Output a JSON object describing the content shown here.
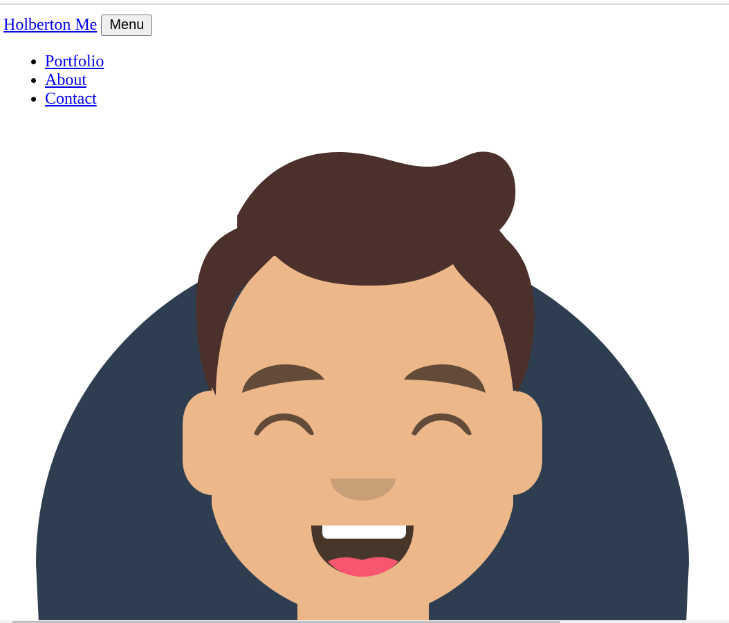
{
  "header": {
    "brand": "Holberton Me",
    "menu_button": "Menu"
  },
  "nav": {
    "items": [
      {
        "label": "Portfolio"
      },
      {
        "label": "About"
      },
      {
        "label": "Contact"
      }
    ]
  },
  "avatar": {
    "icon": "smiling-person-avatar",
    "colors": {
      "background_circle": "#2e3e50",
      "skin": "#ecb789",
      "hair": "#4b302c",
      "eyebrows": "#624b39",
      "nose": "#c99f77",
      "mouth": "#47372a",
      "teeth": "#ffffff",
      "tongue": "#f75570"
    }
  },
  "colors": {
    "link": "#0000ee",
    "page_background": "#ffffff"
  }
}
